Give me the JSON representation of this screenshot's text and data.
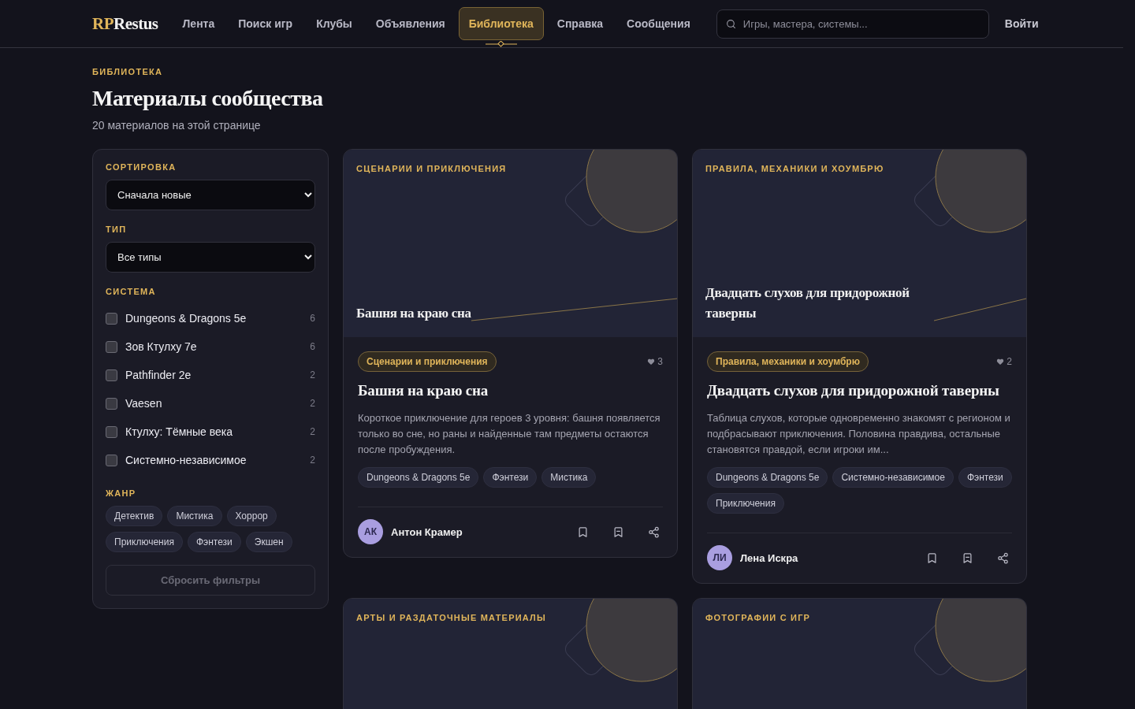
{
  "header": {
    "logo_accent": "RP",
    "logo_rest": "Restus",
    "nav": [
      {
        "label": "Лента",
        "selected": false
      },
      {
        "label": "Поиск игр",
        "selected": false
      },
      {
        "label": "Клубы",
        "selected": false
      },
      {
        "label": "Объявления",
        "selected": false
      },
      {
        "label": "Библиотека",
        "selected": true
      },
      {
        "label": "Справка",
        "selected": false
      },
      {
        "label": "Сообщения",
        "selected": false
      }
    ],
    "search": {
      "placeholder": "Игры, мастера, системы..."
    },
    "login": "Войти"
  },
  "page": {
    "eyebrow": "БИБЛИОТЕКА",
    "title": "Материалы сообщества",
    "subtitle": "20 материалов на этой странице"
  },
  "filters": {
    "sort": {
      "label": "СОРТИРОВКА",
      "value": "Сначала новые"
    },
    "type": {
      "label": "ТИП",
      "value": "Все типы"
    },
    "system": {
      "label": "СИСТЕМА",
      "items": [
        {
          "name": "Dungeons & Dragons 5e",
          "count": "6",
          "checked": false
        },
        {
          "name": "Зов Ктулху 7e",
          "count": "6",
          "checked": false
        },
        {
          "name": "Pathfinder 2e",
          "count": "2",
          "checked": false
        },
        {
          "name": "Vaesen",
          "count": "2",
          "checked": false
        },
        {
          "name": "Ктулху: Тёмные века",
          "count": "2",
          "checked": false
        },
        {
          "name": "Системно-независимое",
          "count": "2",
          "checked": false
        }
      ]
    },
    "genre": {
      "label": "ЖАНР",
      "tags": [
        {
          "label": "Детектив",
          "selected": false
        },
        {
          "label": "Мистика",
          "selected": false
        },
        {
          "label": "Хоррор",
          "selected": false
        },
        {
          "label": "Приключения",
          "selected": false
        },
        {
          "label": "Фэнтези",
          "selected": false
        },
        {
          "label": "Экшен",
          "selected": false
        }
      ]
    },
    "reset": {
      "label": "Сбросить фильтры",
      "disabled": true
    }
  },
  "cards": [
    {
      "cover_label": "СЦЕНАРИИ И ПРИКЛЮЧЕНИЯ",
      "cover_title": "Башня на краю сна",
      "category": "Сценарии и приключения",
      "likes": "3",
      "title": "Башня на краю сна",
      "description": "Короткое приключение для героев 3 уровня: башня появляется только во сне, но раны и найденные там предметы остаются после пробуждения.",
      "tags": [
        "Dungeons & Dragons 5e",
        "Фэнтези",
        "Мистика"
      ],
      "author": {
        "initials": "АК",
        "name": "Антон Крамер"
      }
    },
    {
      "cover_label": "ПРАВИЛА, МЕХАНИКИ И ХОУМБРЮ",
      "cover_title": "Двадцать слухов для придорожной таверны",
      "category": "Правила, механики и хоумбрю",
      "likes": "2",
      "title": "Двадцать слухов для придорожной таверны",
      "description": "Таблица слухов, которые одновременно знакомят с регионом и подбрасывают приключения. Половина правдива, остальные становятся правдой, если игроки им...",
      "tags": [
        "Dungeons & Dragons 5e",
        "Системно-независимое",
        "Фэнтези",
        "Приключения"
      ],
      "author": {
        "initials": "ЛИ",
        "name": "Лена Искра"
      }
    },
    {
      "cover_label": "АРТЫ И РАЗДАТОЧНЫЕ МАТЕРИАЛЫ"
    },
    {
      "cover_label": "ФОТОГРАФИИ С ИГР"
    }
  ]
}
